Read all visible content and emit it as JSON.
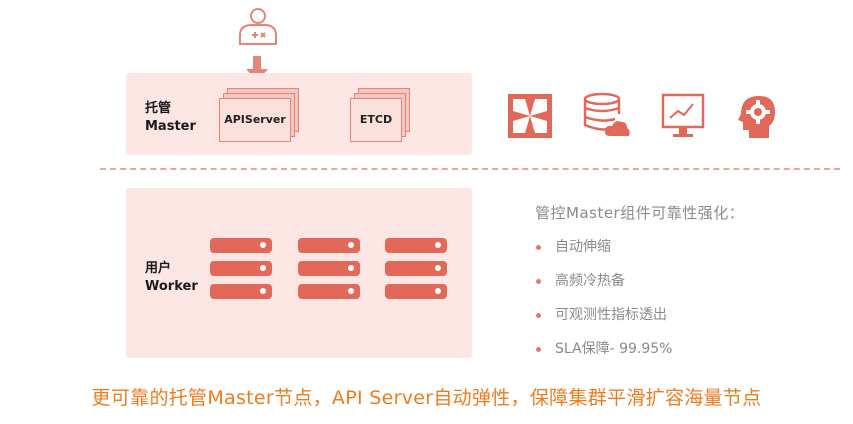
{
  "master": {
    "label_line1": "托管",
    "label_line2": "Master",
    "components": [
      "APIServer",
      "ETCD"
    ]
  },
  "worker": {
    "label_line1": "用户",
    "label_line2": "Worker"
  },
  "icons": [
    "admin-user-icon",
    "down-arrow-icon",
    "expand-arrows-icon",
    "database-cloud-icon",
    "monitor-chart-icon",
    "head-gear-icon",
    "server-rack-icon"
  ],
  "features": {
    "title": "管控Master组件可靠性强化：",
    "items": [
      "自动伸缩",
      "高频冷热备",
      "可观测性指标透出",
      "SLA保障- 99.95%"
    ]
  },
  "caption": "更可靠的托管Master节点，API Server自动弹性，保障集群平滑扩容海量节点",
  "colors": {
    "accent": "#e2685a",
    "panel": "#fbe6e3",
    "caption": "#f07b1d",
    "muted_text": "#8a8a8a"
  }
}
